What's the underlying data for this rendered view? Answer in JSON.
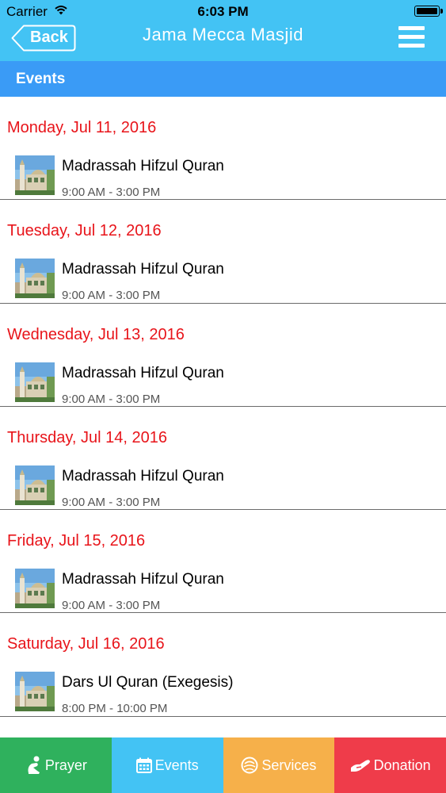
{
  "status_bar": {
    "carrier": "Carrier",
    "time": "6:03 PM"
  },
  "navbar": {
    "back_label": "Back",
    "title": "Jama Mecca Masjid"
  },
  "section": {
    "title": "Events"
  },
  "events": [
    {
      "date": "Monday, Jul 11, 2016",
      "title": "Madrassah Hifzul Quran",
      "time": "9:00 AM - 3:00 PM"
    },
    {
      "date": "Tuesday, Jul 12, 2016",
      "title": "Madrassah Hifzul Quran",
      "time": "9:00 AM - 3:00 PM"
    },
    {
      "date": "Wednesday, Jul 13, 2016",
      "title": "Madrassah Hifzul Quran",
      "time": "9:00 AM - 3:00 PM"
    },
    {
      "date": "Thursday, Jul 14, 2016",
      "title": "Madrassah Hifzul Quran",
      "time": "9:00 AM - 3:00 PM"
    },
    {
      "date": "Friday, Jul 15, 2016",
      "title": "Madrassah Hifzul Quran",
      "time": "9:00 AM - 3:00 PM"
    },
    {
      "date": "Saturday, Jul 16, 2016",
      "title": "Dars Ul Quran (Exegesis)",
      "time": "8:00 PM - 10:00 PM"
    }
  ],
  "tabs": [
    {
      "label": "Prayer",
      "icon": "prayer-icon",
      "color": "#2fb15d"
    },
    {
      "label": "Events",
      "icon": "calendar-icon",
      "color": "#43c3f4"
    },
    {
      "label": "Services",
      "icon": "services-icon",
      "color": "#f6b04a"
    },
    {
      "label": "Donation",
      "icon": "donation-hand-icon",
      "color": "#ef3c4a"
    }
  ],
  "colors": {
    "header": "#43c3f4",
    "section": "#3a9bf6",
    "date_text": "#e8141a"
  }
}
